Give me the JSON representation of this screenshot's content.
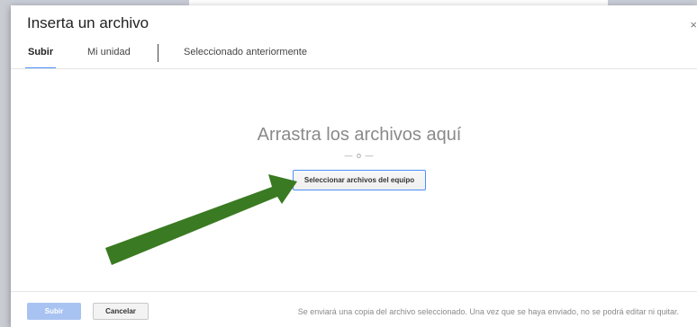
{
  "dialog": {
    "title": "Inserta un archivo",
    "close_glyph": "×"
  },
  "tabs": [
    {
      "label": "Subir",
      "active": true
    },
    {
      "label": "Mi unidad",
      "active": false
    },
    {
      "label": "Seleccionado anteriormente",
      "active": false
    }
  ],
  "upload": {
    "drop_title": "Arrastra los archivos aquí",
    "or_text": "— o —",
    "select_button": "Seleccionar archivos del equipo"
  },
  "footer": {
    "upload_button": "Subir",
    "cancel_button": "Cancelar",
    "note": "Se enviará una copia del archivo seleccionado. Una vez que se haya enviado, no se podrá editar ni quitar."
  },
  "annotation": {
    "arrow_color": "#3a7a22"
  },
  "colors": {
    "accent": "#4d90fe",
    "disabled_button": "#a8c3f2"
  }
}
